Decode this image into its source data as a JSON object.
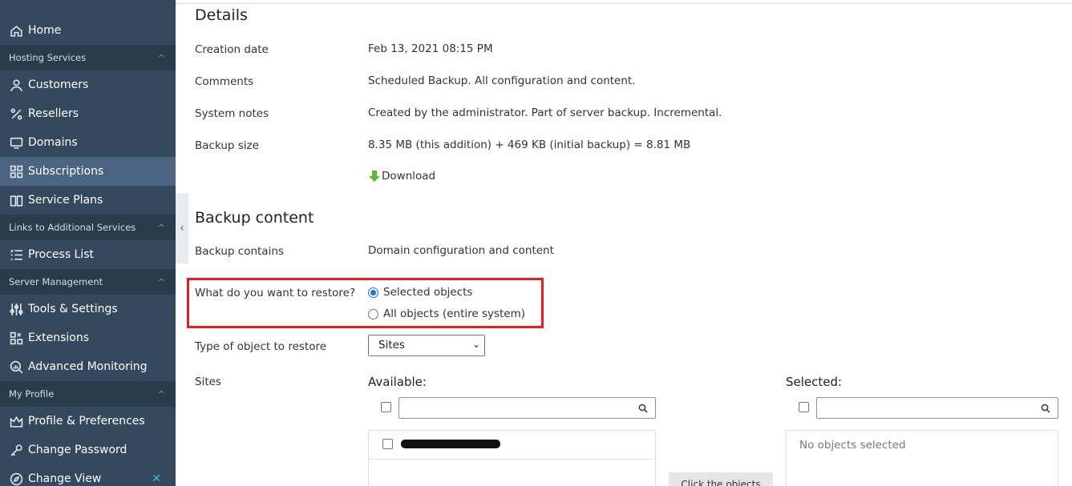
{
  "sidebar": {
    "items": [
      {
        "type": "item",
        "label": "Home",
        "icon": "home-icon"
      },
      {
        "type": "section",
        "label": "Hosting Services"
      },
      {
        "type": "item",
        "label": "Customers",
        "icon": "user-icon"
      },
      {
        "type": "item",
        "label": "Resellers",
        "icon": "percent-icon"
      },
      {
        "type": "item",
        "label": "Domains",
        "icon": "monitor-icon"
      },
      {
        "type": "item",
        "label": "Subscriptions",
        "icon": "grid-icon",
        "active": true
      },
      {
        "type": "item",
        "label": "Service Plans",
        "icon": "book-icon"
      },
      {
        "type": "section",
        "label": "Links to Additional Services"
      },
      {
        "type": "item",
        "label": "Process List",
        "icon": "list-icon"
      },
      {
        "type": "section",
        "label": "Server Management"
      },
      {
        "type": "item",
        "label": "Tools & Settings",
        "icon": "sliders-icon"
      },
      {
        "type": "item",
        "label": "Extensions",
        "icon": "puzzle-icon"
      },
      {
        "type": "item",
        "label": "Advanced Monitoring",
        "icon": "magnifier-chart-icon"
      },
      {
        "type": "section",
        "label": "My Profile"
      },
      {
        "type": "item",
        "label": "Profile & Preferences",
        "icon": "crown-icon"
      },
      {
        "type": "item",
        "label": "Change Password",
        "icon": "key-icon"
      },
      {
        "type": "item",
        "label": "Change View",
        "icon": "compass-icon"
      }
    ]
  },
  "details": {
    "title": "Details",
    "creation_date_label": "Creation date",
    "creation_date": "Feb 13, 2021 08:15 PM",
    "comments_label": "Comments",
    "comments": "Scheduled Backup. All configuration and content.",
    "system_notes_label": "System notes",
    "system_notes": "Created by the administrator. Part of server backup. Incremental.",
    "backup_size_label": "Backup size",
    "backup_size": "8.35 MB (this addition) + 469 KB (initial backup) = 8.81 MB",
    "download_label": "Download"
  },
  "backup_content": {
    "title": "Backup content",
    "contains_label": "Backup contains",
    "contains": "Domain configuration and content",
    "restore_question": "What do you want to restore?",
    "restore_options": [
      "Selected objects",
      "All objects (entire system)"
    ],
    "restore_selected": 0,
    "type_label": "Type of object to restore",
    "type_value": "Sites",
    "sites_label": "Sites",
    "available_label": "Available:",
    "selected_label": "Selected:",
    "no_objects": "No objects selected",
    "click_button": "Click the objects"
  },
  "colors": {
    "sidebar_bg": "#34495e",
    "section_bg": "#2a3b4c",
    "accent": "#36b6e8",
    "link": "#1f83b5",
    "highlight": "#e31e24"
  }
}
